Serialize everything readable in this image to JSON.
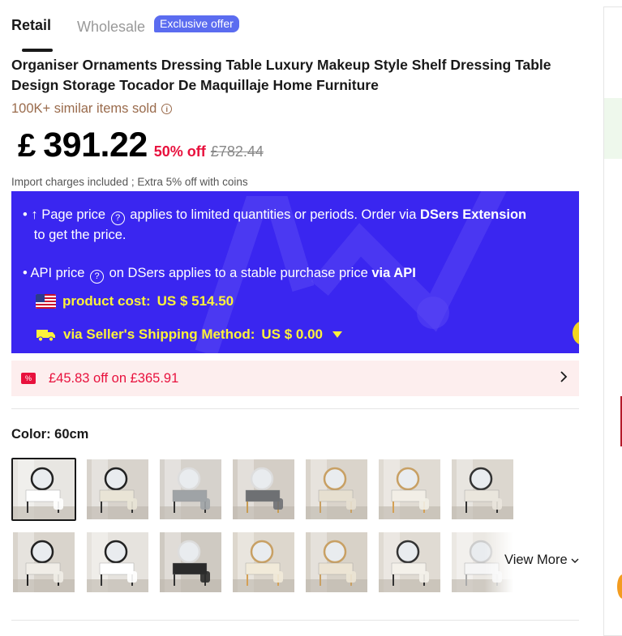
{
  "tabs": {
    "retail": "Retail",
    "wholesale": "Wholesale",
    "exclusive_badge": "Exclusive offer"
  },
  "product": {
    "title": "Organiser Ornaments Dressing Table Luxury Makeup Style Shelf Dressing Table Design Storage Tocador De Maquillaje Home Furniture",
    "sold": "100K+ similar items sold",
    "currency": "£",
    "price": "391.22",
    "discount": "50% off",
    "original_price": "£782.44",
    "import_note": "Import charges included ; Extra 5% off with coins"
  },
  "dsers_banner": {
    "line1_prefix": "Page price",
    "line1_mid": "applies to limited quantities or periods. Order via",
    "line1_strong": "DSers Extension",
    "line1_suffix": "to get the price.",
    "line2_prefix": "API price",
    "line2_mid": "on DSers applies to a stable purchase price",
    "line2_strong": "via API",
    "product_cost_label": "product cost:",
    "product_cost_value": "US $ 514.50",
    "shipping_label": "via Seller's Shipping Method:",
    "shipping_value": "US $ 0.00"
  },
  "coupon": {
    "icon_text": "%",
    "text": "£45.83 off on £365.91"
  },
  "color": {
    "label": "Color: 60cm",
    "view_more": "View More"
  },
  "colors": {
    "accent": "#3a26f0",
    "price_red": "#e8113d",
    "badge_blue": "#5b6cf0",
    "highlight_yellow": "#fdf23a"
  },
  "thumbnails": [
    {
      "name": "variant-1",
      "table": "#ffffff",
      "ring": "#222",
      "legs": "#333",
      "bg": "#e8e6e2"
    },
    {
      "name": "variant-2",
      "table": "#e9e4d6",
      "ring": "#222",
      "legs": "#333",
      "bg": "#d8d3cc"
    },
    {
      "name": "variant-3",
      "table": "#9fa3a6",
      "ring": "#ddd",
      "legs": "#333",
      "bg": "#d6d2cc"
    },
    {
      "name": "variant-4",
      "table": "#6e7073",
      "ring": "#ddd",
      "legs": "#c79c52",
      "bg": "#d4cec6"
    },
    {
      "name": "variant-5",
      "table": "#e6dfd0",
      "ring": "#c8a064",
      "legs": "#c8a064",
      "bg": "#dad4cb"
    },
    {
      "name": "variant-6",
      "table": "#f2eee6",
      "ring": "#c8a064",
      "legs": "#d4a055",
      "bg": "#e0dbd3"
    },
    {
      "name": "variant-7",
      "table": "#eae6dd",
      "ring": "#333",
      "legs": "#333",
      "bg": "#dcd7cf"
    },
    {
      "name": "variant-8",
      "table": "#f0ede7",
      "ring": "#222",
      "legs": "#222",
      "bg": "#d9d4cc"
    },
    {
      "name": "variant-9",
      "table": "#ffffff",
      "ring": "#222",
      "legs": "#333",
      "bg": "#e6e3de"
    },
    {
      "name": "variant-10",
      "table": "#2b2b2b",
      "ring": "#ddd",
      "legs": "#333",
      "bg": "#cfcac2"
    },
    {
      "name": "variant-11",
      "table": "#f1ead9",
      "ring": "#c8a064",
      "legs": "#d4a055",
      "bg": "#ddd7cd"
    },
    {
      "name": "variant-12",
      "table": "#ece4d4",
      "ring": "#c8a064",
      "legs": "#c8a064",
      "bg": "#d8d2c8"
    },
    {
      "name": "variant-13",
      "table": "#f4f1ea",
      "ring": "#333",
      "legs": "#333",
      "bg": "#e0dbd3"
    },
    {
      "name": "variant-14",
      "table": "#f5f5f5",
      "ring": "#ccc",
      "legs": "#aaa",
      "bg": "#ebe8e3"
    }
  ]
}
